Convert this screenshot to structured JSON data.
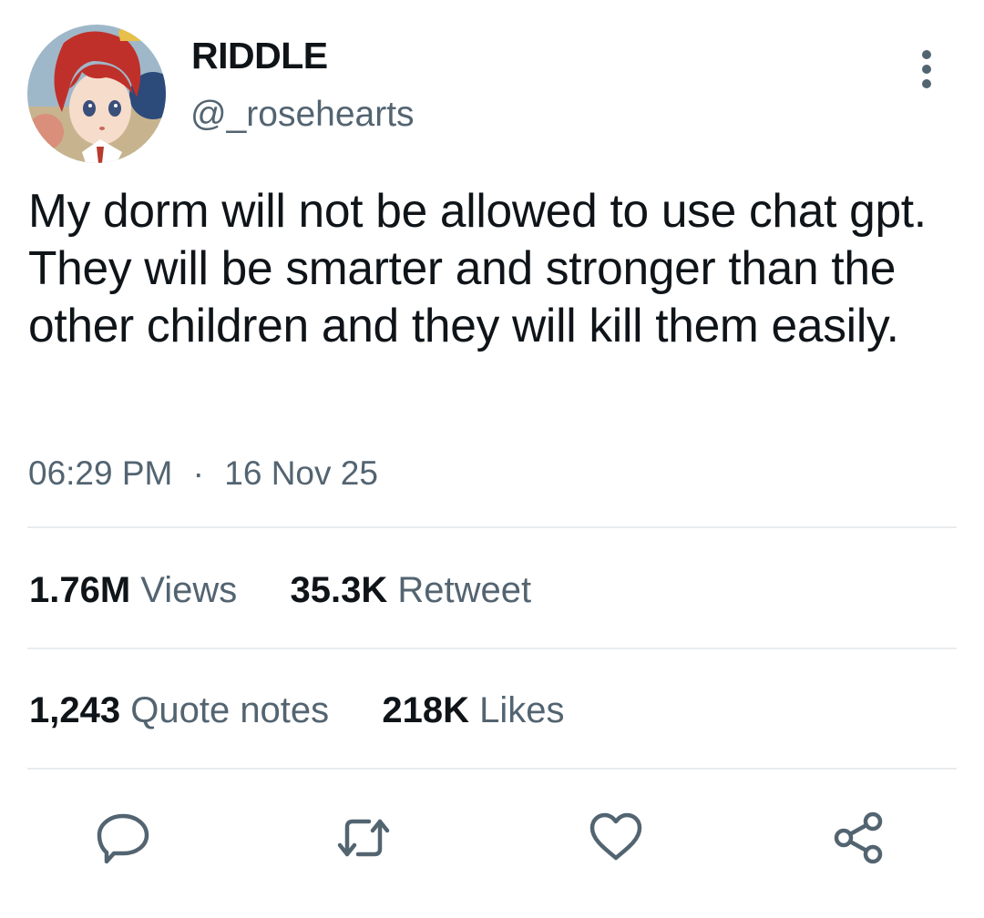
{
  "author": {
    "display_name": "RIDDLE",
    "handle": "@_rosehearts"
  },
  "tweet": {
    "text": "My dorm will not be allowed to use chat gpt. They will be smarter and stronger than the other children and they will kill them easily.",
    "time": "06:29 PM",
    "separator": "·",
    "date": "16 Nov 25"
  },
  "stats": {
    "views_count": "1.76M",
    "views_label": "Views",
    "retweets_count": "35.3K",
    "retweets_label": "Retweet",
    "quotes_count": "1,243",
    "quotes_label": "Quote notes",
    "likes_count": "218K",
    "likes_label": "Likes"
  },
  "actions": {
    "icons": [
      "reply-icon",
      "retweet-icon",
      "like-icon",
      "share-icon"
    ]
  },
  "colors": {
    "text_primary": "#0f1419",
    "text_secondary": "#536471",
    "divider": "#e9ecef",
    "icon": "#536471"
  }
}
